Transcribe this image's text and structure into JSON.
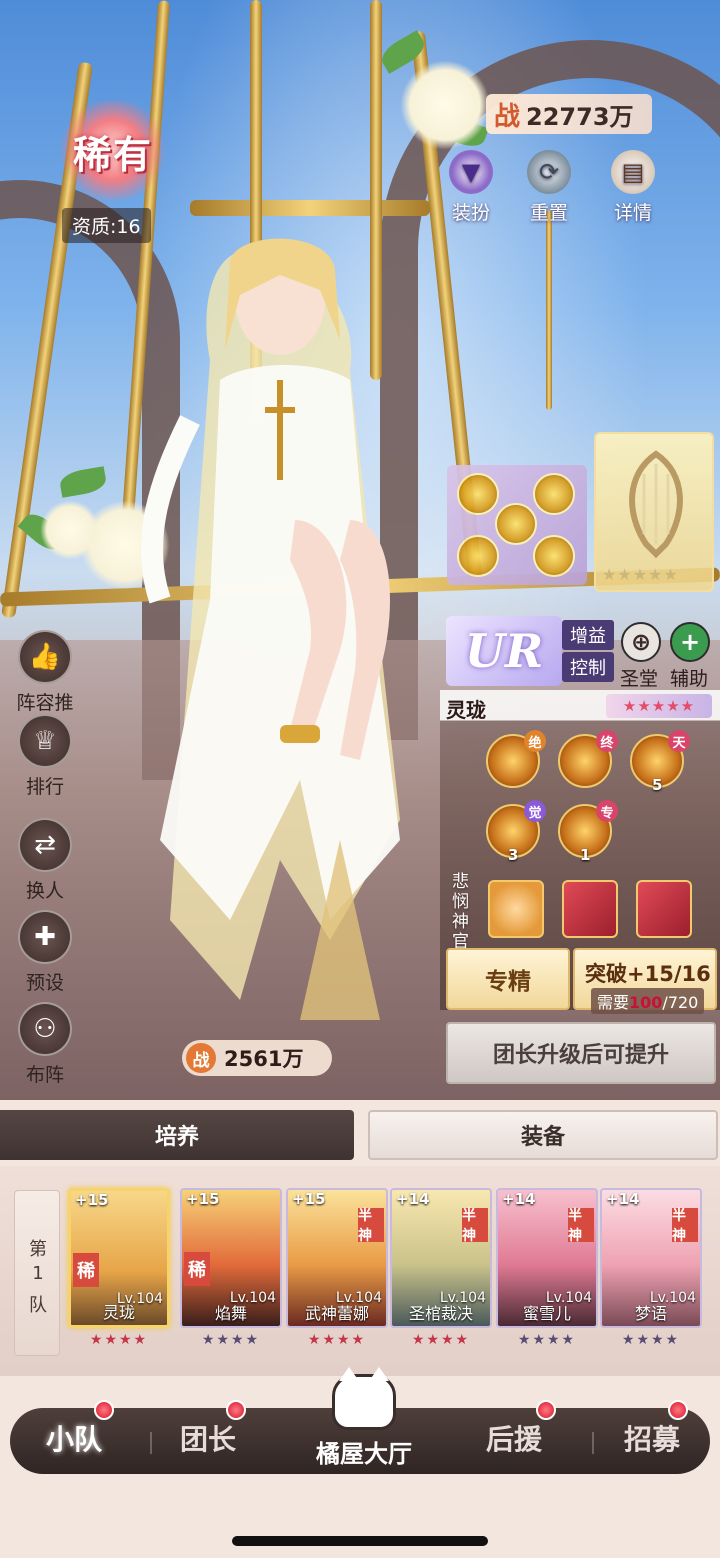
{
  "rarity": {
    "label": "稀有",
    "quality": "资质:16"
  },
  "power_top": {
    "prefix": "战",
    "value": "22773万"
  },
  "top_actions": [
    {
      "label": "装扮",
      "icon": "dress-icon"
    },
    {
      "label": "重置",
      "icon": "reset-icon"
    },
    {
      "label": "详情",
      "icon": "book-icon"
    }
  ],
  "sidebar": [
    {
      "label": "阵容推荐",
      "icon": "thumbs-up-icon"
    },
    {
      "label": "排行",
      "icon": "trophy-icon"
    },
    {
      "label": "换人",
      "icon": "swap-icon"
    },
    {
      "label": "预设",
      "icon": "gamepad-icon"
    },
    {
      "label": "布阵",
      "icon": "formation-icon"
    }
  ],
  "hero": {
    "rank": "UR",
    "tags": [
      "增益",
      "控制"
    ],
    "faction": {
      "label": "圣堂",
      "icon": "crosshair-icon"
    },
    "role": {
      "label": "辅助",
      "icon": "plus-icon"
    },
    "name": "灵珑",
    "stars": "★★★★★",
    "skills": [
      {
        "badge": "绝",
        "num": ""
      },
      {
        "badge": "终",
        "num": ""
      },
      {
        "badge": "天",
        "num": "5"
      },
      {
        "badge": "觉",
        "num": "3"
      },
      {
        "badge": "专",
        "num": "1"
      }
    ],
    "fav_label": "悲悯神官",
    "artifact_stars": "★★★★★",
    "power": {
      "prefix": "战",
      "value": "2561万"
    }
  },
  "buttons": {
    "exclusive": "专精",
    "breakthrough": "突破+15/16",
    "need_label": "需要",
    "need_have": "100",
    "need_total": "/720",
    "upgrade": "团长升级后可提升"
  },
  "tabs": {
    "cultivate": "培养",
    "equipment": "装备"
  },
  "team": {
    "label_chars": [
      "第",
      "1",
      "队"
    ],
    "members": [
      {
        "plus": "+15",
        "level": "Lv.104",
        "name": "灵珑",
        "badge": "稀",
        "stars": "★★★★"
      },
      {
        "plus": "+15",
        "level": "Lv.104",
        "name": "焰舞",
        "badge": "稀",
        "stars": "★★★★"
      },
      {
        "plus": "+15",
        "level": "Lv.104",
        "name": "武神蕾娜",
        "badge": "半神",
        "stars": "★★★★"
      },
      {
        "plus": "+14",
        "level": "Lv.104",
        "name": "圣棺裁决",
        "badge": "半神",
        "stars": "★★★★"
      },
      {
        "plus": "+14",
        "level": "Lv.104",
        "name": "蜜雪儿",
        "badge": "半神",
        "stars": "★★★★"
      },
      {
        "plus": "+14",
        "level": "Lv.104",
        "name": "梦语",
        "badge": "半神",
        "stars": "★★★★"
      }
    ]
  },
  "nav": {
    "squad": "小队",
    "leader": "团长",
    "hall": "橘屋大厅",
    "support": "后援",
    "recruit": "招募"
  }
}
